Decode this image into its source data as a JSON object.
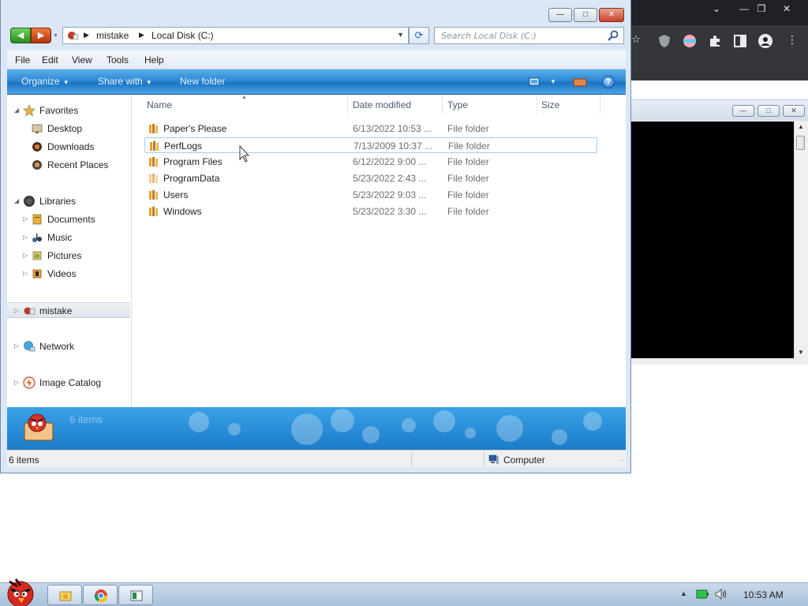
{
  "explorer": {
    "breadcrumbs": [
      "mistake",
      "Local Disk (C:)"
    ],
    "search_placeholder": "Search Local Disk (C:)",
    "menu": [
      "File",
      "Edit",
      "View",
      "Tools",
      "Help"
    ],
    "toolbar": {
      "organize": "Organize",
      "share_with": "Share with",
      "new_folder": "New folder",
      "help": "?"
    },
    "nav": {
      "favorites": "Favorites",
      "desktop": "Desktop",
      "downloads": "Downloads",
      "recent_places": "Recent Places",
      "libraries": "Libraries",
      "documents": "Documents",
      "music": "Music",
      "pictures": "Pictures",
      "videos": "Videos",
      "mistake": "mistake",
      "network": "Network",
      "image_catalog": "Image Catalog"
    },
    "columns": [
      "Name",
      "Date modified",
      "Type",
      "Size"
    ],
    "files": [
      {
        "name": "Paper's Please",
        "date": "6/13/2022 10:53 ...",
        "type": "File folder",
        "size": ""
      },
      {
        "name": "PerfLogs",
        "date": "7/13/2009 10:37 ...",
        "type": "File folder",
        "size": ""
      },
      {
        "name": "Program Files",
        "date": "6/12/2022 9:00 ...",
        "type": "File folder",
        "size": ""
      },
      {
        "name": "ProgramData",
        "date": "5/23/2022 2:43 ...",
        "type": "File folder",
        "size": ""
      },
      {
        "name": "Users",
        "date": "5/23/2022 9:03 ...",
        "type": "File folder",
        "size": ""
      },
      {
        "name": "Windows",
        "date": "5/23/2022 3:30 ...",
        "type": "File folder",
        "size": ""
      }
    ],
    "details_text": "6 items",
    "status_left": "6 items",
    "status_location": "Computer"
  },
  "taskbar": {
    "clock": "10:53 AM"
  },
  "colors": {
    "command_bar": "#2e8ad6",
    "details_pane": "#1b7bc8",
    "selection_border": "#a9cfee",
    "chrome_toolbar": "#35363a"
  },
  "icons": [
    "back-arrow-icon",
    "forward-arrow-icon",
    "refresh-icon",
    "search-icon",
    "folder-icon",
    "star-icon",
    "computer-icon",
    "network-icon",
    "speaker-icon",
    "battery-icon",
    "chrome-icon"
  ]
}
